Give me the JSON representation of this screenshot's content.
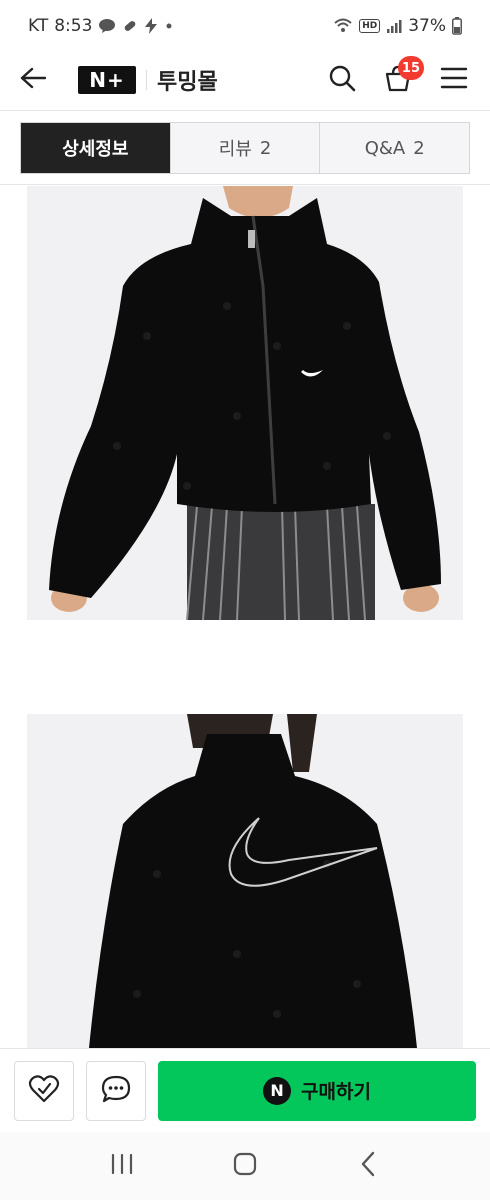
{
  "status_bar": {
    "carrier": "KT",
    "time": "8:53",
    "battery": "37%"
  },
  "header": {
    "logo": "N+",
    "store_name": "투밍몰",
    "cart_count": "15"
  },
  "tabs": [
    {
      "label": "상세정보",
      "count": ""
    },
    {
      "label": "리뷰",
      "count": "2"
    },
    {
      "label": "Q&A",
      "count": "2"
    }
  ],
  "action_bar": {
    "pay_logo": "N",
    "buy_label": "구매하기"
  },
  "icons": {
    "back": "back-arrow-icon",
    "search": "search-icon",
    "cart": "cart-icon",
    "menu": "menu-icon",
    "wishlist": "heart-check-icon",
    "talk": "chat-icon"
  },
  "colors": {
    "buy_green": "#03c75a",
    "cart_badge": "#f23a2f",
    "active_tab": "#222222"
  }
}
